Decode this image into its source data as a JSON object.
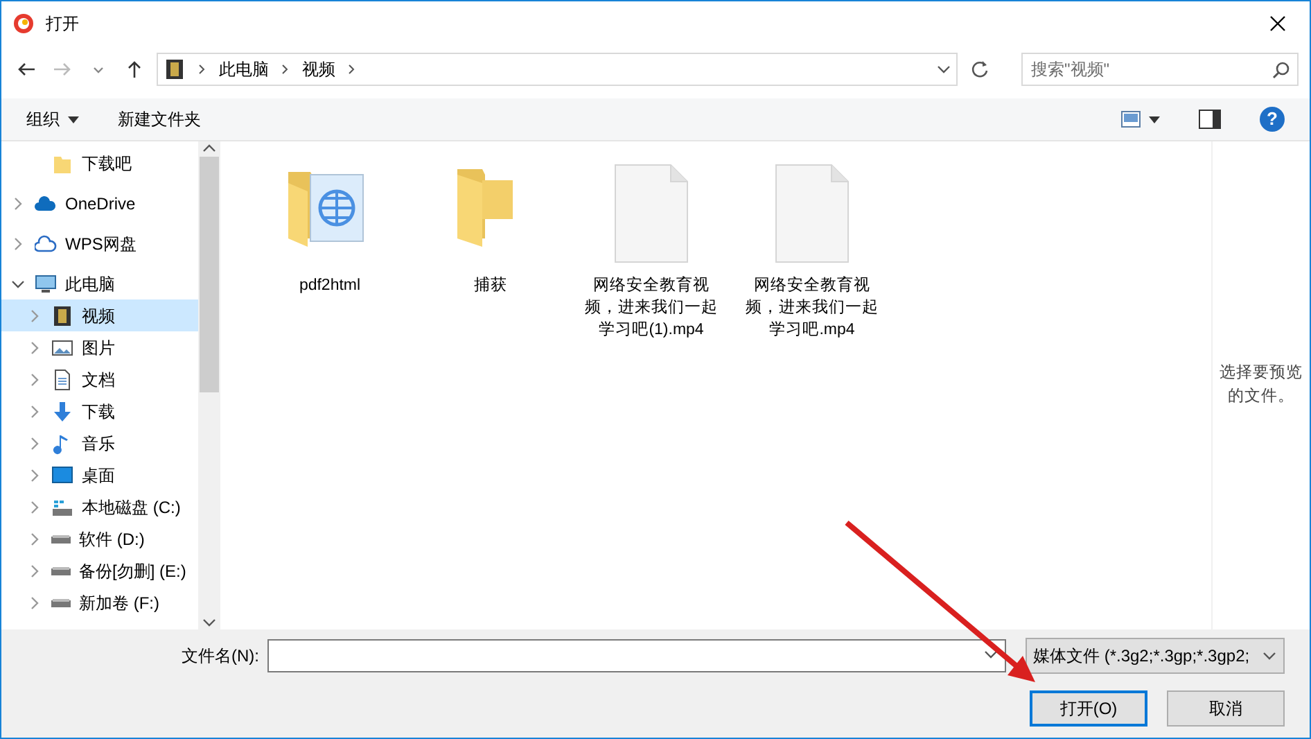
{
  "window": {
    "title": "打开"
  },
  "address": {
    "path": [
      "此电脑",
      "视频"
    ],
    "search_placeholder": "搜索\"视频\""
  },
  "toolbar": {
    "organize": "组织",
    "new_folder": "新建文件夹",
    "help": "?"
  },
  "sidebar": {
    "items": [
      {
        "label": "下载吧",
        "kind": "folder",
        "expandable": false,
        "expanded": false,
        "selected": false
      },
      {
        "label": "OneDrive",
        "kind": "cloud",
        "expandable": true,
        "expanded": false,
        "selected": false
      },
      {
        "label": "WPS网盘",
        "kind": "cloud-outline",
        "expandable": true,
        "expanded": false,
        "selected": false
      },
      {
        "label": "此电脑",
        "kind": "pc",
        "expandable": true,
        "expanded": true,
        "selected": false,
        "children": [
          {
            "label": "视频",
            "kind": "video",
            "expandable": true,
            "expanded": false,
            "selected": true
          },
          {
            "label": "图片",
            "kind": "pictures",
            "expandable": true,
            "expanded": false,
            "selected": false
          },
          {
            "label": "文档",
            "kind": "document",
            "expandable": true,
            "expanded": false,
            "selected": false
          },
          {
            "label": "下载",
            "kind": "download",
            "expandable": true,
            "expanded": false,
            "selected": false
          },
          {
            "label": "音乐",
            "kind": "music",
            "expandable": true,
            "expanded": false,
            "selected": false
          },
          {
            "label": "桌面",
            "kind": "desktop",
            "expandable": true,
            "expanded": false,
            "selected": false
          },
          {
            "label": "本地磁盘 (C:)",
            "kind": "system-drive",
            "expandable": true,
            "expanded": false,
            "selected": false
          },
          {
            "label": "软件 (D:)",
            "kind": "drive",
            "expandable": true,
            "expanded": false,
            "selected": false
          },
          {
            "label": "备份[勿删] (E:)",
            "kind": "drive",
            "expandable": true,
            "expanded": false,
            "selected": false
          },
          {
            "label": "新加卷 (F:)",
            "kind": "drive",
            "expandable": true,
            "expanded": false,
            "selected": false
          }
        ]
      }
    ]
  },
  "files": [
    {
      "name": "pdf2html",
      "kind": "web-folder"
    },
    {
      "name": "捕获",
      "kind": "folder"
    },
    {
      "name": "网络安全教育视频，进来我们一起学习吧(1).mp4",
      "kind": "file"
    },
    {
      "name": "网络安全教育视频，进来我们一起学习吧.mp4",
      "kind": "file"
    }
  ],
  "preview": {
    "message": "选择要预览的文件。"
  },
  "footer": {
    "filename_label": "文件名(N):",
    "filter": "媒体文件 (*.3g2;*.3gp;*.3gp2;",
    "buttons": [
      {
        "label": "打开(O)",
        "kind": "primary"
      },
      {
        "label": "取消",
        "kind": "secondary"
      }
    ]
  },
  "annotation": {
    "arrow": true
  }
}
